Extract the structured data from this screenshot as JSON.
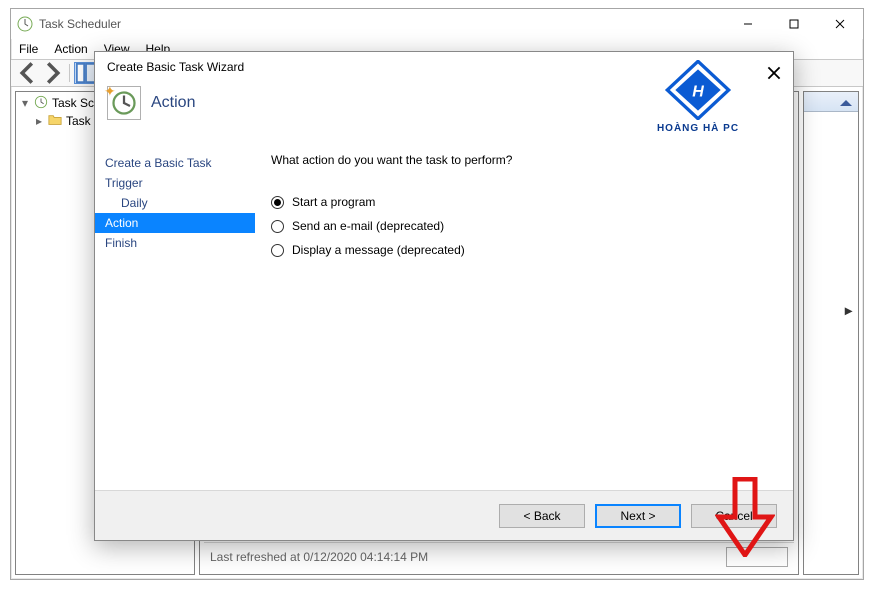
{
  "main_window": {
    "title": "Task Scheduler",
    "menu": {
      "file": "File",
      "action": "Action",
      "view": "View",
      "help": "Help"
    },
    "tree": {
      "root": "Task Scheduler (Local)",
      "child": "Task Scheduler Library"
    },
    "center_status": "Last refreshed at 0/12/2020 04:14:14 PM"
  },
  "dialog": {
    "title": "Create Basic Task Wizard",
    "brand_text": "HOÀNG HÀ PC",
    "step_title": "Action",
    "nav": {
      "basic": "Create a Basic Task",
      "trigger": "Trigger",
      "daily": "Daily",
      "action": "Action",
      "finish": "Finish"
    },
    "prompt": "What action do you want the task to perform?",
    "options": {
      "start_program": "Start a program",
      "send_email": "Send an e-mail (deprecated)",
      "display_message": "Display a message (deprecated)"
    },
    "buttons": {
      "back": "< Back",
      "next": "Next >",
      "cancel": "Cancel"
    }
  }
}
